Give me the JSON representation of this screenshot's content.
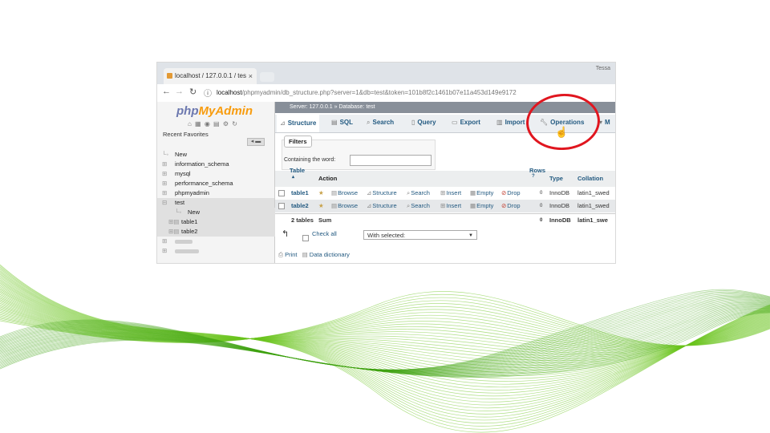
{
  "browser": {
    "tab_title": "localhost / 127.0.0.1 / tes",
    "tab_close": "×",
    "user_label": "Tessa",
    "url_host": "localhost",
    "url_path": "/phpmyadmin/db_structure.php?server=1&db=test&token=101b8f2c1461b07e11a453d149e9172"
  },
  "sidebar": {
    "logo_a": "php",
    "logo_b": "MyAdmin",
    "tabs": "Recent   Favorites",
    "tree": [
      "New",
      "information_schema",
      "mysql",
      "performance_schema",
      "phpmyadmin",
      "test"
    ],
    "test_children": [
      "New",
      "table1",
      "table2"
    ]
  },
  "main": {
    "breadcrumb": "Server: 127.0.0.1 » Database: test",
    "menu": [
      "Structure",
      "SQL",
      "Search",
      "Query",
      "Export",
      "Import",
      "Operations",
      "M"
    ],
    "filters_title": "Filters",
    "filters_label": "Containing the word:",
    "headers": {
      "table": "Table",
      "action": "Action",
      "rows": "Rows",
      "type": "Type",
      "collation": "Collation"
    },
    "actions": [
      "Browse",
      "Structure",
      "Search",
      "Insert",
      "Empty",
      "Drop"
    ],
    "rows": [
      {
        "name": "table1",
        "rows": "0",
        "type": "InnoDB",
        "collation": "latin1_swed"
      },
      {
        "name": "table2",
        "rows": "0",
        "type": "InnoDB",
        "collation": "latin1_swed"
      }
    ],
    "sum": {
      "label": "2 tables",
      "sum_word": "Sum",
      "rows": "0",
      "type": "InnoDB",
      "collation": "latin1_swe"
    },
    "check_all": "Check all",
    "with_selected": "With selected:",
    "print": "Print",
    "data_dictionary": "Data dictionary"
  },
  "colors": {
    "highlight_ring": "#e0161f",
    "wave_green": "#6cc51f",
    "link": "#235a81"
  }
}
